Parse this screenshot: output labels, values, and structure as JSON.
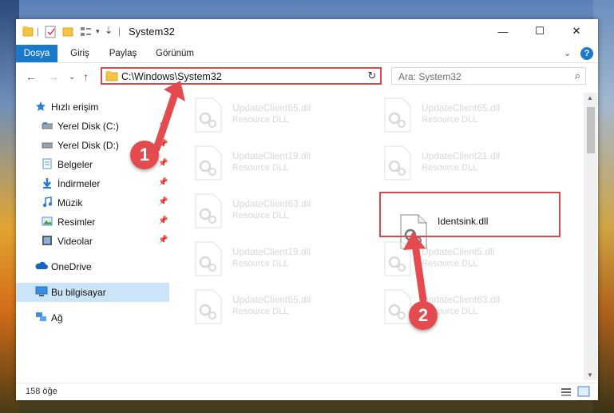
{
  "window": {
    "title": "System32",
    "controls": {
      "minimize": "—",
      "maximize": "☐",
      "close": "✕"
    }
  },
  "ribbon": {
    "tabs": [
      {
        "label": "Dosya"
      },
      {
        "label": "Giriş"
      },
      {
        "label": "Paylaş"
      },
      {
        "label": "Görünüm"
      }
    ],
    "help": "?"
  },
  "address": {
    "path": "C:\\Windows\\System32",
    "search_placeholder": "Ara: System32"
  },
  "navigation": {
    "items": [
      {
        "label": "Hızlı erişim",
        "icon": "star-icon"
      },
      {
        "label": "Yerel Disk (C:)",
        "icon": "drive-icon"
      },
      {
        "label": "Yerel Disk (D:)",
        "icon": "drive-icon"
      },
      {
        "label": "Belgeler",
        "icon": "documents-icon"
      },
      {
        "label": "İndirmeler",
        "icon": "download-icon"
      },
      {
        "label": "Müzik",
        "icon": "music-icon"
      },
      {
        "label": "Resimler",
        "icon": "pictures-icon"
      },
      {
        "label": "Videolar",
        "icon": "videos-icon"
      },
      {
        "label": "OneDrive",
        "icon": "cloud-icon"
      },
      {
        "label": "Bu bilgisayar",
        "icon": "computer-icon",
        "selected": true
      },
      {
        "label": "Ağ",
        "icon": "network-icon"
      }
    ]
  },
  "files": [
    {
      "name": "UpdateClient65.dll",
      "type": "Resource DLL"
    },
    {
      "name": "UpdateClient65.dll",
      "type": "Resource DLL"
    },
    {
      "name": "UpdateClient19.dll",
      "type": "Resource DLL"
    },
    {
      "name": "UpdateClient21.dll",
      "type": "Resource DLL"
    },
    {
      "name": "UpdateClient63.dll",
      "type": "Resource DLL"
    },
    {
      "name": "Identsink.dll",
      "type": ""
    },
    {
      "name": "UpdateClient19.dll",
      "type": "Resource DLL"
    },
    {
      "name": "UpdateClient5.dll",
      "type": "Resource DLL"
    },
    {
      "name": "UpdateClient65.dll",
      "type": "Resource DLL"
    },
    {
      "name": "UpdateClient63.dll",
      "type": "Resource DLL"
    }
  ],
  "status": {
    "item_count": "158 öğe"
  },
  "callouts": [
    "1",
    "2"
  ],
  "colors": {
    "accent": "#1979ca",
    "highlight": "#d9464b",
    "selection": "#cce4f7"
  }
}
